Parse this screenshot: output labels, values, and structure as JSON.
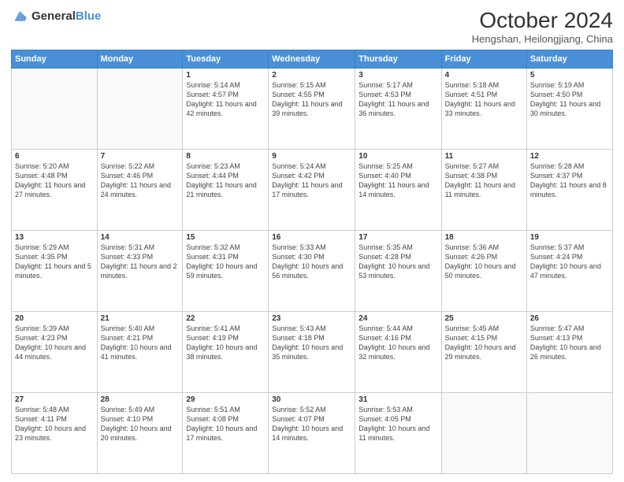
{
  "header": {
    "logo_general": "General",
    "logo_blue": "Blue",
    "title": "October 2024",
    "subtitle": "Hengshan, Heilongjiang, China"
  },
  "days_of_week": [
    "Sunday",
    "Monday",
    "Tuesday",
    "Wednesday",
    "Thursday",
    "Friday",
    "Saturday"
  ],
  "weeks": [
    [
      {
        "day": "",
        "sunrise": "",
        "sunset": "",
        "daylight": ""
      },
      {
        "day": "",
        "sunrise": "",
        "sunset": "",
        "daylight": ""
      },
      {
        "day": "1",
        "sunrise": "Sunrise: 5:14 AM",
        "sunset": "Sunset: 4:57 PM",
        "daylight": "Daylight: 11 hours and 42 minutes."
      },
      {
        "day": "2",
        "sunrise": "Sunrise: 5:15 AM",
        "sunset": "Sunset: 4:55 PM",
        "daylight": "Daylight: 11 hours and 39 minutes."
      },
      {
        "day": "3",
        "sunrise": "Sunrise: 5:17 AM",
        "sunset": "Sunset: 4:53 PM",
        "daylight": "Daylight: 11 hours and 36 minutes."
      },
      {
        "day": "4",
        "sunrise": "Sunrise: 5:18 AM",
        "sunset": "Sunset: 4:51 PM",
        "daylight": "Daylight: 11 hours and 33 minutes."
      },
      {
        "day": "5",
        "sunrise": "Sunrise: 5:19 AM",
        "sunset": "Sunset: 4:50 PM",
        "daylight": "Daylight: 11 hours and 30 minutes."
      }
    ],
    [
      {
        "day": "6",
        "sunrise": "Sunrise: 5:20 AM",
        "sunset": "Sunset: 4:48 PM",
        "daylight": "Daylight: 11 hours and 27 minutes."
      },
      {
        "day": "7",
        "sunrise": "Sunrise: 5:22 AM",
        "sunset": "Sunset: 4:46 PM",
        "daylight": "Daylight: 11 hours and 24 minutes."
      },
      {
        "day": "8",
        "sunrise": "Sunrise: 5:23 AM",
        "sunset": "Sunset: 4:44 PM",
        "daylight": "Daylight: 11 hours and 21 minutes."
      },
      {
        "day": "9",
        "sunrise": "Sunrise: 5:24 AM",
        "sunset": "Sunset: 4:42 PM",
        "daylight": "Daylight: 11 hours and 17 minutes."
      },
      {
        "day": "10",
        "sunrise": "Sunrise: 5:25 AM",
        "sunset": "Sunset: 4:40 PM",
        "daylight": "Daylight: 11 hours and 14 minutes."
      },
      {
        "day": "11",
        "sunrise": "Sunrise: 5:27 AM",
        "sunset": "Sunset: 4:38 PM",
        "daylight": "Daylight: 11 hours and 11 minutes."
      },
      {
        "day": "12",
        "sunrise": "Sunrise: 5:28 AM",
        "sunset": "Sunset: 4:37 PM",
        "daylight": "Daylight: 11 hours and 8 minutes."
      }
    ],
    [
      {
        "day": "13",
        "sunrise": "Sunrise: 5:29 AM",
        "sunset": "Sunset: 4:35 PM",
        "daylight": "Daylight: 11 hours and 5 minutes."
      },
      {
        "day": "14",
        "sunrise": "Sunrise: 5:31 AM",
        "sunset": "Sunset: 4:33 PM",
        "daylight": "Daylight: 11 hours and 2 minutes."
      },
      {
        "day": "15",
        "sunrise": "Sunrise: 5:32 AM",
        "sunset": "Sunset: 4:31 PM",
        "daylight": "Daylight: 10 hours and 59 minutes."
      },
      {
        "day": "16",
        "sunrise": "Sunrise: 5:33 AM",
        "sunset": "Sunset: 4:30 PM",
        "daylight": "Daylight: 10 hours and 56 minutes."
      },
      {
        "day": "17",
        "sunrise": "Sunrise: 5:35 AM",
        "sunset": "Sunset: 4:28 PM",
        "daylight": "Daylight: 10 hours and 53 minutes."
      },
      {
        "day": "18",
        "sunrise": "Sunrise: 5:36 AM",
        "sunset": "Sunset: 4:26 PM",
        "daylight": "Daylight: 10 hours and 50 minutes."
      },
      {
        "day": "19",
        "sunrise": "Sunrise: 5:37 AM",
        "sunset": "Sunset: 4:24 PM",
        "daylight": "Daylight: 10 hours and 47 minutes."
      }
    ],
    [
      {
        "day": "20",
        "sunrise": "Sunrise: 5:39 AM",
        "sunset": "Sunset: 4:23 PM",
        "daylight": "Daylight: 10 hours and 44 minutes."
      },
      {
        "day": "21",
        "sunrise": "Sunrise: 5:40 AM",
        "sunset": "Sunset: 4:21 PM",
        "daylight": "Daylight: 10 hours and 41 minutes."
      },
      {
        "day": "22",
        "sunrise": "Sunrise: 5:41 AM",
        "sunset": "Sunset: 4:19 PM",
        "daylight": "Daylight: 10 hours and 38 minutes."
      },
      {
        "day": "23",
        "sunrise": "Sunrise: 5:43 AM",
        "sunset": "Sunset: 4:18 PM",
        "daylight": "Daylight: 10 hours and 35 minutes."
      },
      {
        "day": "24",
        "sunrise": "Sunrise: 5:44 AM",
        "sunset": "Sunset: 4:16 PM",
        "daylight": "Daylight: 10 hours and 32 minutes."
      },
      {
        "day": "25",
        "sunrise": "Sunrise: 5:45 AM",
        "sunset": "Sunset: 4:15 PM",
        "daylight": "Daylight: 10 hours and 29 minutes."
      },
      {
        "day": "26",
        "sunrise": "Sunrise: 5:47 AM",
        "sunset": "Sunset: 4:13 PM",
        "daylight": "Daylight: 10 hours and 26 minutes."
      }
    ],
    [
      {
        "day": "27",
        "sunrise": "Sunrise: 5:48 AM",
        "sunset": "Sunset: 4:11 PM",
        "daylight": "Daylight: 10 hours and 23 minutes."
      },
      {
        "day": "28",
        "sunrise": "Sunrise: 5:49 AM",
        "sunset": "Sunset: 4:10 PM",
        "daylight": "Daylight: 10 hours and 20 minutes."
      },
      {
        "day": "29",
        "sunrise": "Sunrise: 5:51 AM",
        "sunset": "Sunset: 4:08 PM",
        "daylight": "Daylight: 10 hours and 17 minutes."
      },
      {
        "day": "30",
        "sunrise": "Sunrise: 5:52 AM",
        "sunset": "Sunset: 4:07 PM",
        "daylight": "Daylight: 10 hours and 14 minutes."
      },
      {
        "day": "31",
        "sunrise": "Sunrise: 5:53 AM",
        "sunset": "Sunset: 4:05 PM",
        "daylight": "Daylight: 10 hours and 11 minutes."
      },
      {
        "day": "",
        "sunrise": "",
        "sunset": "",
        "daylight": ""
      },
      {
        "day": "",
        "sunrise": "",
        "sunset": "",
        "daylight": ""
      }
    ]
  ]
}
